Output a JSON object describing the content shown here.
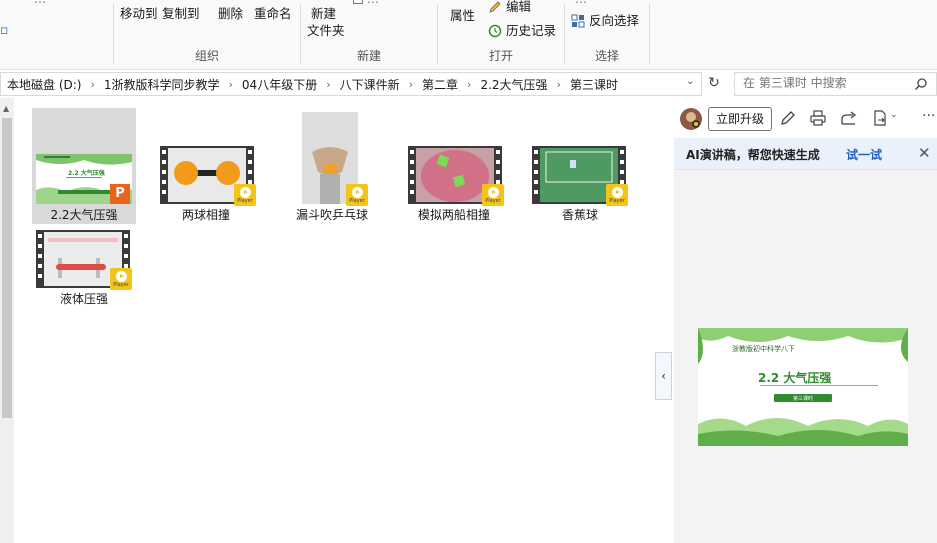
{
  "ribbon": {
    "clip_left": "…",
    "clip_mid": "…",
    "clip_right": "…",
    "organize": {
      "move_to": "移动到",
      "copy_to": "复制到",
      "delete": "删除",
      "rename": "重命名",
      "label": "组织"
    },
    "new": {
      "new_folder_line1": "新建",
      "new_folder_line2": "文件夹",
      "label": "新建"
    },
    "open": {
      "properties": "属性",
      "edit": "编辑",
      "history": "历史记录",
      "label": "打开"
    },
    "select": {
      "invert": "反向选择",
      "label": "选择"
    }
  },
  "address": {
    "crumbs": [
      "本地磁盘 (D:)",
      "1浙教版科学同步教学",
      "04八年级下册",
      "八下课件新",
      "第二章",
      "2.2大气压强",
      "第三课时"
    ],
    "separator": "›",
    "dropdown": "⌄",
    "refresh": "↻"
  },
  "search": {
    "placeholder": "在 第三课时 中搜索"
  },
  "files": [
    {
      "name": "2.2大气压强",
      "type": "ppt"
    },
    {
      "name": "两球相撞",
      "type": "video"
    },
    {
      "name": "漏斗吹乒乓球",
      "type": "video"
    },
    {
      "name": "模拟两船相撞",
      "type": "video"
    },
    {
      "name": "香蕉球",
      "type": "video"
    },
    {
      "name": "液体压强",
      "type": "video"
    }
  ],
  "badge_text": "Player",
  "ppt_badge": "P",
  "pane": {
    "upgrade": "立即升级",
    "ai_banner": "AI演讲稿，帮您快速生成",
    "ai_link": "试一试",
    "close": "✕",
    "more": "···",
    "collapse": "‹",
    "slide_subtitle": "浙教版初中科学八下",
    "slide_title": "2.2  大气压强",
    "slide_button": "第三课时"
  },
  "colors": {
    "accent": "#1f5fbf",
    "badge": "#f3c41a",
    "ppt": "#e8641b",
    "green": "#2e8b2e"
  }
}
